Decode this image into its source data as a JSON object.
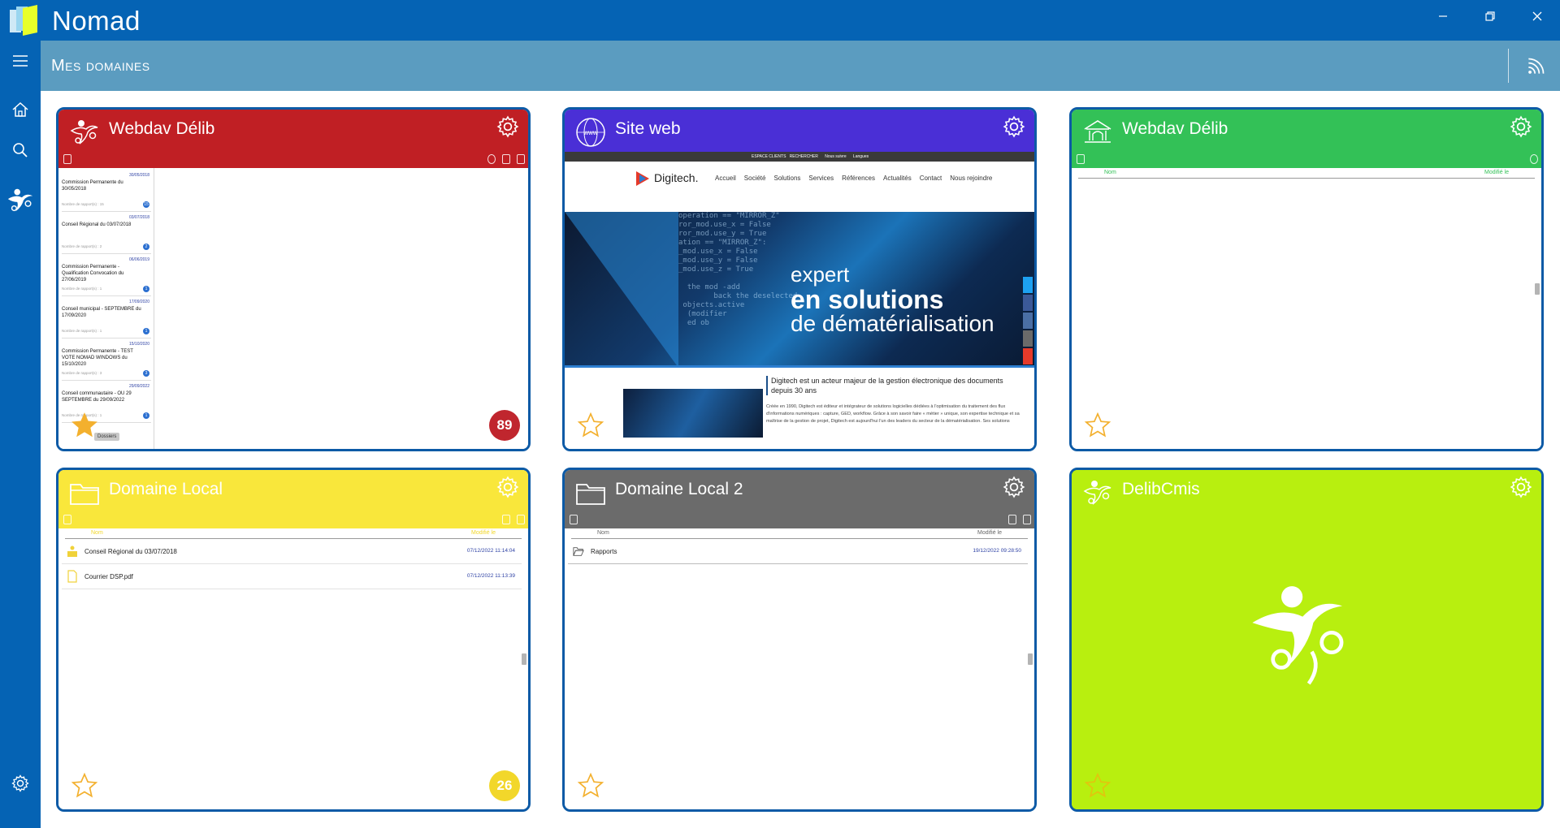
{
  "app": {
    "title": "Nomad"
  },
  "header": {
    "title": "Mes domaines"
  },
  "cards": [
    {
      "title": "Webdav Délib",
      "color": "#c01f24",
      "icon": "people-logo-icon",
      "badge": "89",
      "badge_color": "#c0262e",
      "favorite": true,
      "tooltip": "Dossiers",
      "sessions": [
        {
          "date": "30/05/2018",
          "title": "Commission Permanente  du 30/05/2018",
          "sub": "Nombre de rapport(s) : 15",
          "count": "15"
        },
        {
          "date": "03/07/2018",
          "title": "Conseil Régional  du 03/07/2018",
          "sub": "Nombre de rapport(s) : 2",
          "count": "2"
        },
        {
          "date": "06/06/2019",
          "title": "Commission Permanente  - Qualification Convocation du 27/06/2019",
          "sub": "Nombre de rapport(s) : 1",
          "count": "1"
        },
        {
          "date": "17/09/2020",
          "title": "Conseil municipal  - SEPTEMBRE du 17/09/2020",
          "sub": "Nombre de rapport(s) : 1",
          "count": "1"
        },
        {
          "date": "15/10/2020",
          "title": "Commission Permanente  - TEST VOTE NOMAD WINDOWS du 15/10/2020",
          "sub": "Nombre de rapport(s) : 3",
          "count": "3"
        },
        {
          "date": "29/09/2022",
          "title": "Conseil communautaire  - OU 29 SEPTEMBRE du 29/09/2022",
          "sub": "Nombre de rapport(s) : 1",
          "count": "1"
        }
      ]
    },
    {
      "title": "Site web",
      "color": "#4a2fd6",
      "icon": "www-globe-icon",
      "favorite": false,
      "site": {
        "topbar": "ESPACE CLIENTS   RECHERCHER      Nous suivre      Langues",
        "logo": "Digitech.",
        "menu": [
          "Accueil",
          "Société",
          "Solutions",
          "Services",
          "Références",
          "Actualités",
          "Contact",
          "Nous rejoindre"
        ],
        "hero_line1": "expert",
        "hero_line2": "en solutions",
        "hero_line3": "de dématérialisation",
        "intro": "Digitech est un acteur majeur de la gestion électronique des documents depuis 30 ans",
        "para": "Créée en 1990, Digitech est éditeur et intégrateur de solutions logicielles dédiées à l'optimisation du traitement des flux d'informations numériques : capture, GED, workflow. Grâce à son savoir faire « métier » unique, son expertise technique et sa maîtrise de la gestion de projet, Digitech est aujourd'hui l'un des leaders du secteur de la dématérialisation. Ses solutions"
      }
    },
    {
      "title": "Webdav Délib",
      "color": "#33c157",
      "icon": "institution-building-icon",
      "favorite": false,
      "list": {
        "col_name": "Nom",
        "col_date": "Modifié le",
        "rows": []
      }
    },
    {
      "title": "Domaine Local",
      "color": "#f9e73b",
      "icon": "folder-icon",
      "badge": "26",
      "badge_color": "#f2d72a",
      "favorite": false,
      "list": {
        "col_name": "Nom",
        "col_date": "Modifié le",
        "rows": [
          {
            "name": "Conseil Régional  du 03/07/2018",
            "date": "07/12/2022 11:14:04",
            "kind": "session"
          },
          {
            "name": "Courrier DSP.pdf",
            "date": "07/12/2022 11:13:39",
            "kind": "file"
          }
        ]
      }
    },
    {
      "title": "Domaine Local 2",
      "color": "#6b6b6b",
      "icon": "folder-icon",
      "favorite": false,
      "list": {
        "col_name": "Nom",
        "col_date": "Modifié le",
        "rows": [
          {
            "name": "Rapports",
            "date": "19/12/2022 09:28:50",
            "kind": "folder"
          }
        ]
      }
    },
    {
      "title": "DelibCmis",
      "color": "#b8ef0f",
      "icon": "people-logo-icon",
      "favorite": false
    }
  ]
}
